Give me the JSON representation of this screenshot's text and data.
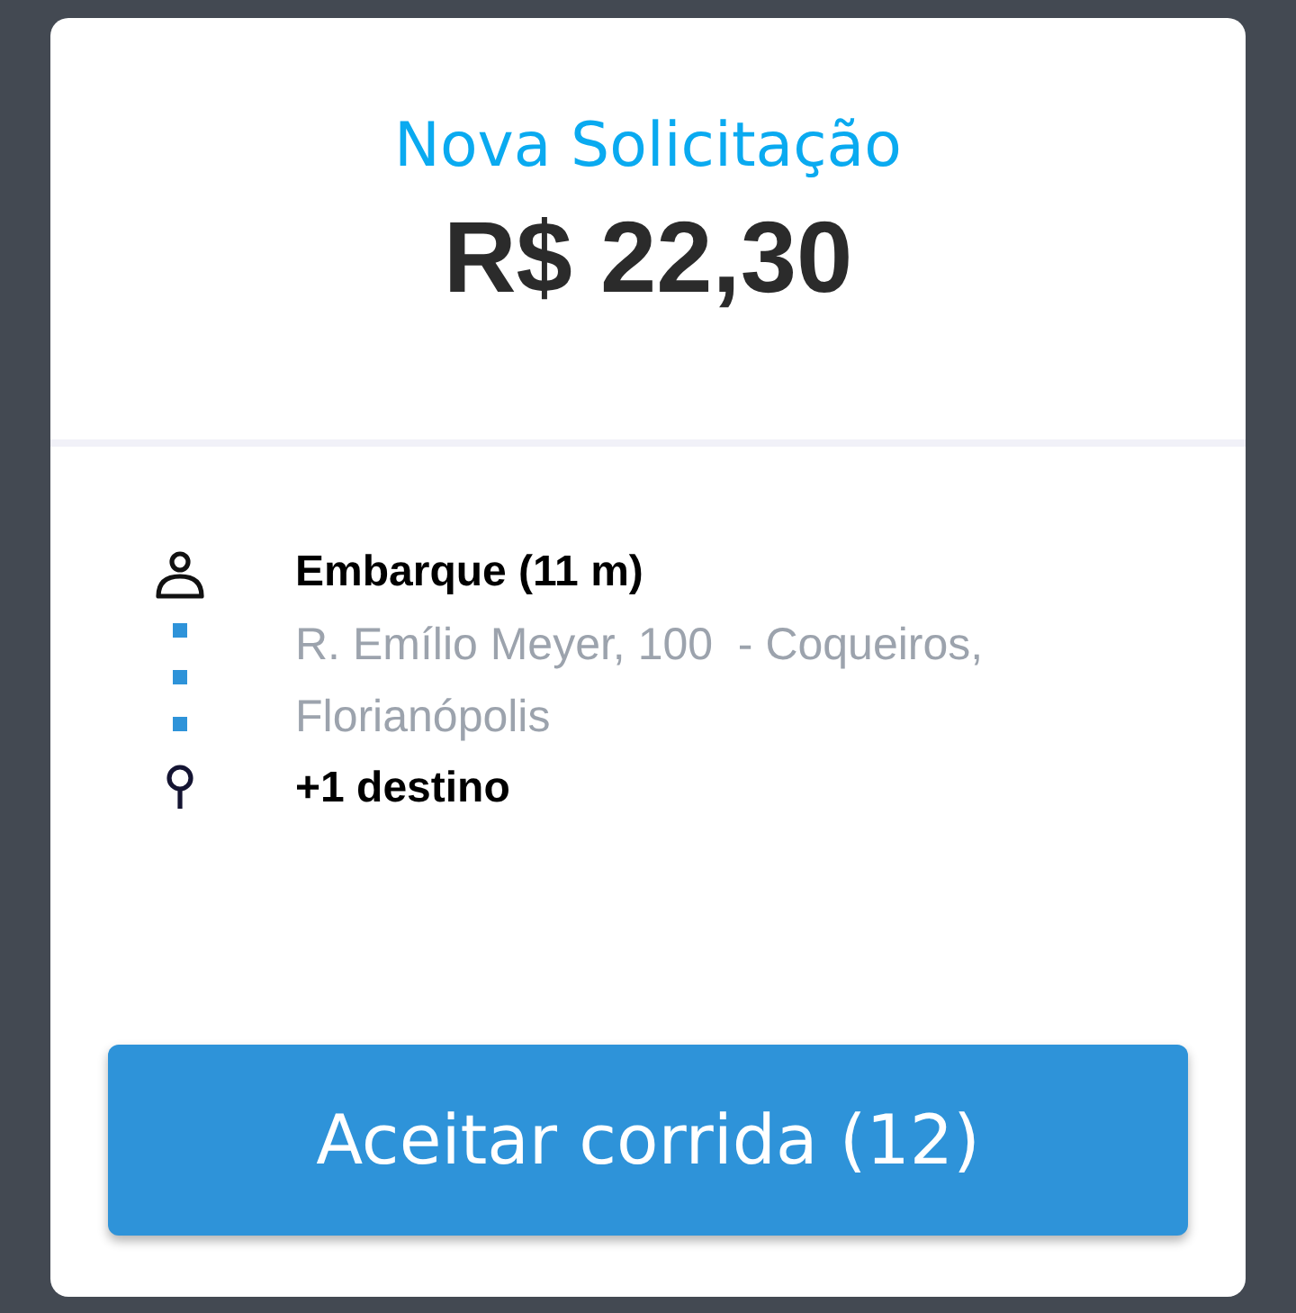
{
  "card": {
    "title": "Nova Solicitação",
    "price": "R$ 22,30"
  },
  "stops": [
    {
      "kind": "pickup",
      "label": "Embarque (11 m)",
      "address": "R. Emílio Meyer, 100  - Coqueiros, Florianópolis"
    },
    {
      "kind": "destination",
      "label": "+1 destino"
    }
  ],
  "accept_button": "Aceitar corrida (12)"
}
